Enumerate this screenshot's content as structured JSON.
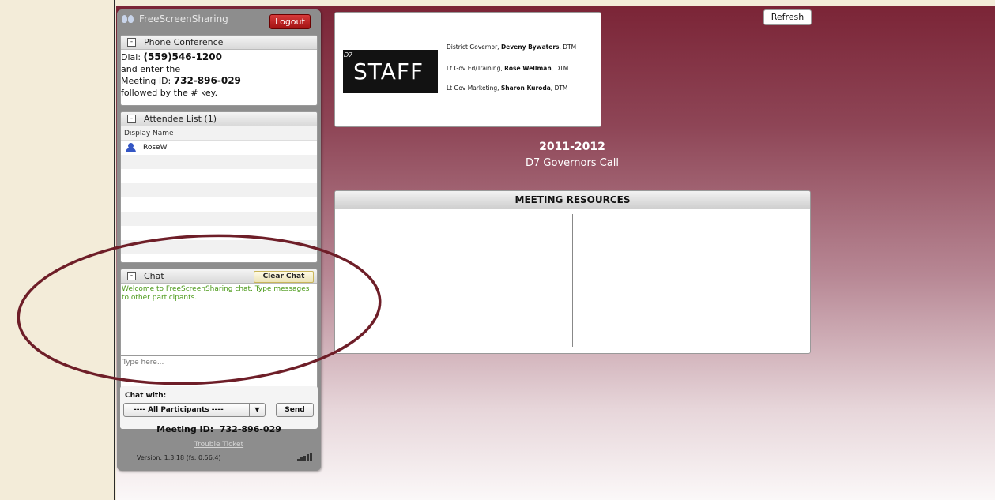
{
  "brand": {
    "name": "FreeScreenSharing"
  },
  "header": {
    "logout_label": "Logout",
    "refresh_label": "Refresh"
  },
  "phone": {
    "title": "Phone Conference",
    "toggle": "-",
    "dial_prefix": "Dial:",
    "dial_number": "(559)546-1200",
    "line2": "and enter the",
    "meeting_prefix": "Meeting ID:",
    "meeting_id": "732-896-029",
    "line4": "followed by the # key."
  },
  "attendees": {
    "title": "Attendee List (1)",
    "toggle": "-",
    "column": "Display Name",
    "rows": [
      "RoseW",
      "",
      "",
      "",
      "",
      "",
      "",
      ""
    ]
  },
  "chat": {
    "title": "Chat",
    "toggle": "-",
    "clear_label": "Clear Chat",
    "welcome": "Welcome to FreeScreenSharing chat. Type messages to other participants.",
    "input_placeholder": "Type here...",
    "chat_with_label": "Chat with:",
    "recipient": "---- All Participants ----",
    "send_label": "Send"
  },
  "footer": {
    "meeting_id_label": "Meeting ID:",
    "meeting_id": "732-896-029",
    "trouble_ticket": "Trouble Ticket",
    "version": "Version: 1.3.18 (fs: 0.56.4)"
  },
  "staff": {
    "logo_prefix": "D7",
    "logo_word": "STAFF",
    "officers": [
      {
        "role": "District Governor,",
        "name": "Deveny Bywaters",
        "suffix": ", DTM"
      },
      {
        "role": "Lt Gov Ed/Training,",
        "name": "Rose Wellman",
        "suffix": ", DTM"
      },
      {
        "role": "Lt Gov Marketing,",
        "name": "Sharon Kuroda",
        "suffix": ", DTM"
      }
    ]
  },
  "main": {
    "year": "2011-2012",
    "subtitle": "D7 Governors Call",
    "resources_title": "MEETING RESOURCES"
  },
  "colors": {
    "background_top": "#7a2335",
    "annotation_ellipse": "#6e1e28",
    "logout": "#b81b1b",
    "chat_text": "#4c9a1a"
  },
  "icons": [
    "user-icon",
    "signal-strength-icon",
    "toggle-minus-icon",
    "dropdown-arrow-icon"
  ]
}
